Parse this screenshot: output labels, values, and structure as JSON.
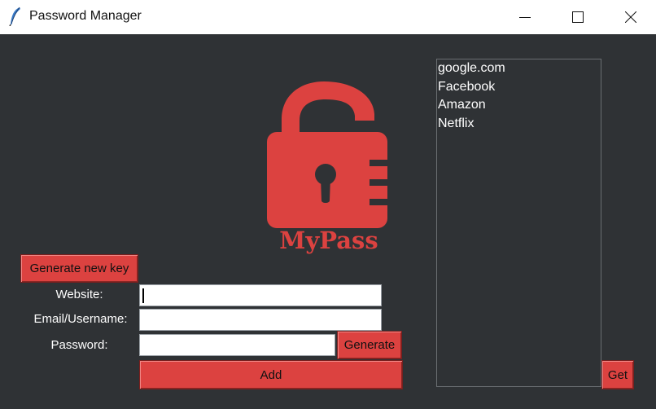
{
  "window": {
    "title": "Password Manager",
    "icon": "feather-icon",
    "controls": [
      "minimize-icon",
      "maximize-icon",
      "close-icon"
    ]
  },
  "colors": {
    "background": "#2f3235",
    "accent": "#dc4240",
    "text": "#ffffff"
  },
  "logo": {
    "text": "MyPass",
    "icon": "padlock-icon"
  },
  "buttons": {
    "generate_key": "Generate new key",
    "generate": "Generate",
    "add": "Add",
    "get": "Get"
  },
  "form": {
    "website_label": "Website:",
    "website_value": "",
    "email_label": "Email/Username:",
    "email_value": "",
    "password_label": "Password:",
    "password_value": ""
  },
  "sites": [
    "google.com",
    "Facebook",
    "Amazon",
    "Netflix"
  ]
}
